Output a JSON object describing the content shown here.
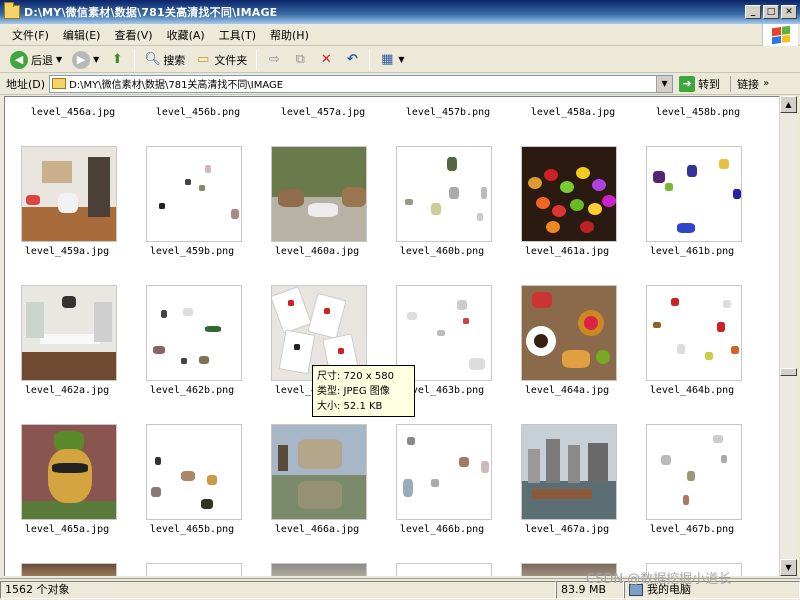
{
  "window": {
    "title": "D:\\MY\\微信素材\\数据\\781关高清找不同\\IMAGE"
  },
  "menu": [
    "文件(F)",
    "编辑(E)",
    "查看(V)",
    "收藏(A)",
    "工具(T)",
    "帮助(H)"
  ],
  "toolbar": {
    "back": "后退",
    "search": "搜索",
    "folders": "文件夹"
  },
  "address": {
    "label": "地址(D)",
    "path": "D:\\MY\\微信素材\\数据\\781关高清找不同\\IMAGE",
    "go": "转到",
    "links": "链接"
  },
  "files": {
    "row0": [
      "level_456a.jpg",
      "level_456b.png",
      "level_457a.jpg",
      "level_457b.png",
      "level_458a.jpg",
      "level_458b.png"
    ],
    "row1": [
      "level_459a.jpg",
      "level_459b.png",
      "level_460a.jpg",
      "level_460b.png",
      "level_461a.jpg",
      "level_461b.png"
    ],
    "row2": [
      "level_462a.jpg",
      "level_462b.png",
      "level_463a.jpg",
      "level_463b.png",
      "level_464a.jpg",
      "level_464b.png"
    ],
    "row3": [
      "level_465a.jpg",
      "level_465b.png",
      "level_466a.jpg",
      "level_466b.png",
      "level_467a.jpg",
      "level_467b.png"
    ]
  },
  "tooltip": {
    "size": "尺寸: 720 x 580",
    "type": "类型: JPEG 图像",
    "filesize": "大小: 52.1 KB"
  },
  "status": {
    "count": "1562 个对象",
    "size": "83.9 MB",
    "location": "我的电脑"
  },
  "watermark": "CSDN @数据挖掘小道长",
  "icons": {
    "back": "back-arrow-icon",
    "forward": "forward-arrow-icon",
    "up": "up-folder-icon",
    "search": "search-icon",
    "folders": "folders-icon",
    "move": "move-to-icon",
    "copy": "copy-to-icon",
    "delete": "delete-icon",
    "undo": "undo-icon",
    "views": "views-icon"
  }
}
